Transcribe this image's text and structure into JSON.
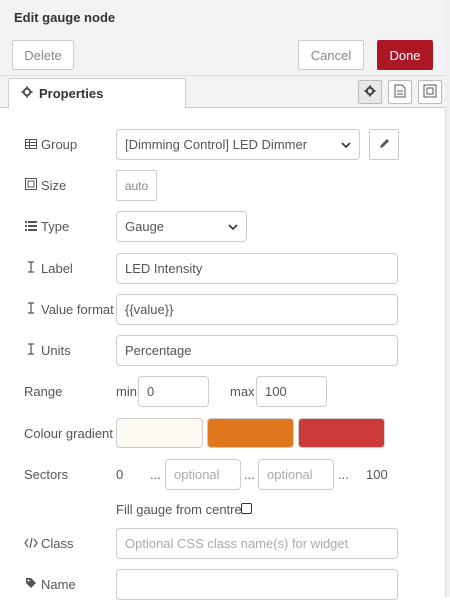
{
  "dialog": {
    "title": "Edit gauge node",
    "delete_label": "Delete",
    "cancel_label": "Cancel",
    "done_label": "Done"
  },
  "tabs": {
    "properties_label": "Properties"
  },
  "form": {
    "group": {
      "label": "Group",
      "value": "[Dimming Control] LED Dimmer",
      "icon": "table-icon"
    },
    "size": {
      "label": "Size",
      "value": "auto",
      "icon": "resize-icon"
    },
    "type": {
      "label": "Type",
      "value": "Gauge",
      "icon": "list-icon"
    },
    "label_field": {
      "label": "Label",
      "value": "LED Intensity",
      "icon": "text-cursor-icon"
    },
    "value_format": {
      "label": "Value format",
      "value": "{{value}}",
      "icon": "text-cursor-icon"
    },
    "units": {
      "label": "Units",
      "value": "Percentage",
      "icon": "text-cursor-icon"
    },
    "range": {
      "label": "Range",
      "min_label": "min",
      "min_value": "0",
      "max_label": "max",
      "max_value": "100"
    },
    "colour_gradient": {
      "label": "Colour gradient",
      "colors": [
        "#fdfaf3",
        "#e0771d",
        "#cc3a3a"
      ]
    },
    "sectors": {
      "label": "Sectors",
      "start": "0",
      "dots1": "...",
      "placeholder1": "optional",
      "dots2": "...",
      "placeholder2": "optional",
      "dots3": "...",
      "end": "100"
    },
    "fill_from_centre": {
      "label": "Fill gauge from centre."
    },
    "class": {
      "label": "Class",
      "placeholder": "Optional CSS class name(s) for widget",
      "icon": "code-icon"
    },
    "name": {
      "label": "Name",
      "value": "",
      "icon": "tag-icon"
    }
  },
  "colors": {
    "primary": "#ad1625",
    "header_bg": "#f3f3f3",
    "border": "#cccccc"
  }
}
